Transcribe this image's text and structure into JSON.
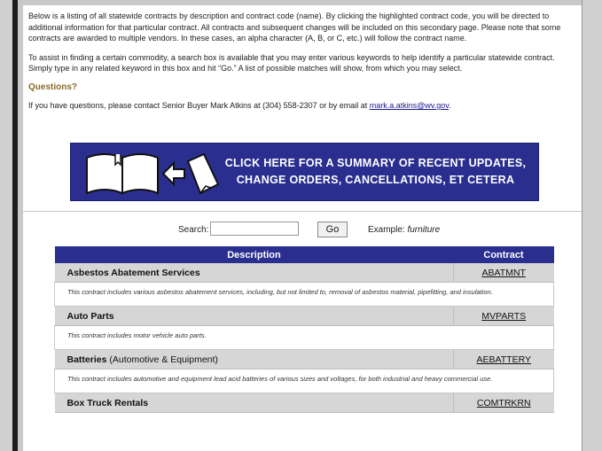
{
  "intro": {
    "paragraph1": "Below is a listing of all statewide contracts by description and contract code (name).  By clicking the highlighted contract code, you will be directed to additional information for that particular contract.  All contracts and subsequent changes will be included on this secondary page.  Please note that some contracts are awarded to multiple vendors.  In these cases, an alpha character (A, B, or C, etc.) will follow the contract name.",
    "paragraph2": "To assist in finding a certain commodity, a search box is available that you may enter various keywords to help identify a particular statewide contract.  Simply type in any related keyword in this box and hit “Go.”  A list of possible matches will show, from which you may select.",
    "questions_heading": "Questions?",
    "contact_prefix": "If you have questions, please contact Senior Buyer Mark Atkins at (304) 558-2307 or by email at ",
    "contact_email": "mark.a.atkins@wv.gov",
    "contact_suffix": "."
  },
  "banner": {
    "line1": "Click here for a summary of recent updates,",
    "line2": "change orders, cancellations, et cetera",
    "icon": "open-book-arrow-page-icon"
  },
  "search": {
    "label": "Search:",
    "value": "",
    "go_label": "Go",
    "example_label": "Example:",
    "example_value": "furniture"
  },
  "table": {
    "headers": {
      "description": "Description",
      "contract": "Contract"
    },
    "rows": [
      {
        "title": "Asbestos Abatement Services",
        "subtitle": "",
        "code": "ABATMNT",
        "description": "This contract includes various asbestos abatement services, including, but not limited to, removal of asbestos material, pipefitting, and insulation."
      },
      {
        "title": "Auto Parts",
        "subtitle": "",
        "code": "MVPARTS",
        "description": "This contract includes motor vehicle auto parts."
      },
      {
        "title": "Batteries",
        "subtitle": "(Automotive & Equipment)",
        "code": "AEBATTERY",
        "description": "This contract includes automotive and equipment lead acid batteries of various sizes and voltages, for both industrial and heavy commercial use."
      },
      {
        "title": "Box Truck Rentals",
        "subtitle": "",
        "code": "COMTRKRN",
        "description": ""
      }
    ]
  },
  "colors": {
    "navy": "#2a2f8f",
    "heading_gold": "#8a6a2a",
    "row_gray": "#d6d6d6"
  }
}
